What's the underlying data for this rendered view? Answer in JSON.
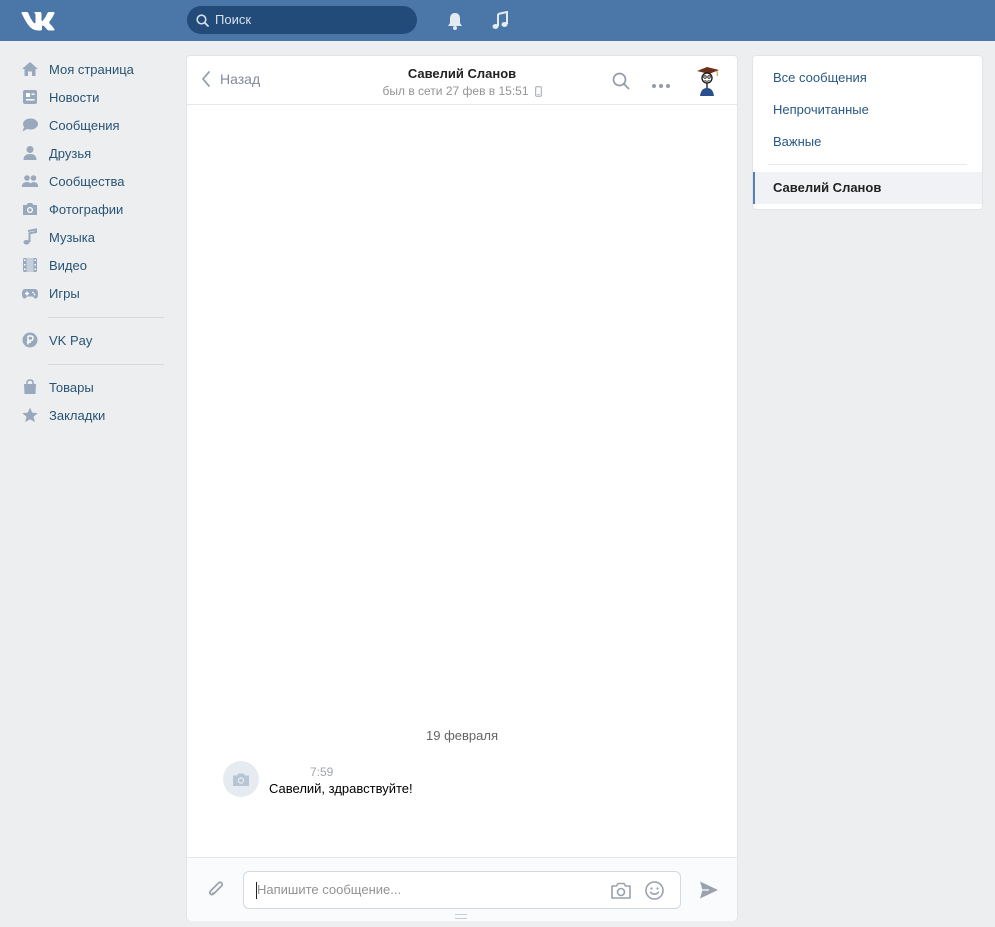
{
  "header": {
    "search_placeholder": "Поиск"
  },
  "nav": {
    "items": [
      {
        "label": "Моя страница",
        "icon": "home-icon"
      },
      {
        "label": "Новости",
        "icon": "news-icon"
      },
      {
        "label": "Сообщения",
        "icon": "messages-icon"
      },
      {
        "label": "Друзья",
        "icon": "friends-icon"
      },
      {
        "label": "Сообщества",
        "icon": "groups-icon"
      },
      {
        "label": "Фотографии",
        "icon": "camera-icon"
      },
      {
        "label": "Музыка",
        "icon": "music-icon"
      },
      {
        "label": "Видео",
        "icon": "video-icon"
      },
      {
        "label": "Игры",
        "icon": "gamepad-icon"
      }
    ],
    "vkpay": "VK Pay",
    "goods": "Товары",
    "bookmarks": "Закладки"
  },
  "chat": {
    "back_label": "Назад",
    "title": "Савелий Сланов",
    "status": "был в сети 27 фев в 15:51",
    "date_separator": "19 февраля",
    "messages": [
      {
        "time": "7:59",
        "text": "Савелий, здравствуйте!"
      }
    ],
    "input_placeholder": "Напишите сообщение..."
  },
  "filters": {
    "all": "Все сообщения",
    "unread": "Непрочитанные",
    "important": "Важные",
    "active_dialog": "Савелий Сланов"
  },
  "colors": {
    "header_bg": "#4a76a8",
    "link": "#2a5885",
    "page_bg": "#edeef0"
  }
}
